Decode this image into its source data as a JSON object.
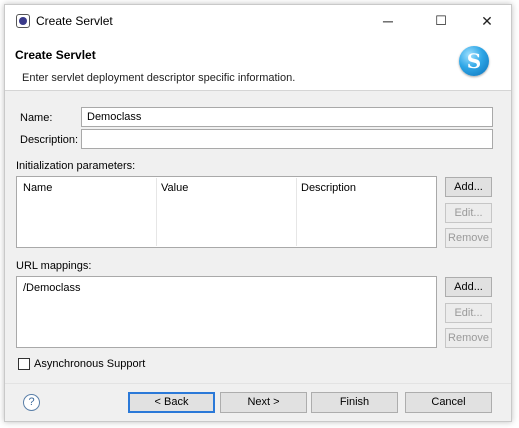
{
  "window": {
    "title": "Create Servlet",
    "minimize_icon": "─",
    "maximize_icon": "☐",
    "close_icon": "✕"
  },
  "header": {
    "title": "Create Servlet",
    "description": "Enter servlet deployment descriptor specific information.",
    "logo_letter": "S"
  },
  "form": {
    "name_label": "Name:",
    "name_value": "Democlass",
    "description_label": "Description:",
    "description_value": ""
  },
  "init_params": {
    "label": "Initialization parameters:",
    "columns": [
      "Name",
      "Value",
      "Description"
    ],
    "add_label": "Add...",
    "edit_label": "Edit...",
    "remove_label": "Remove"
  },
  "url_mappings": {
    "label": "URL mappings:",
    "items": [
      "/Democlass"
    ],
    "add_label": "Add...",
    "edit_label": "Edit...",
    "remove_label": "Remove"
  },
  "async": {
    "label": "Asynchronous Support",
    "checked": false
  },
  "footer": {
    "help_icon": "?",
    "back_label": "< Back",
    "next_label": "Next >",
    "finish_label": "Finish",
    "cancel_label": "Cancel"
  }
}
